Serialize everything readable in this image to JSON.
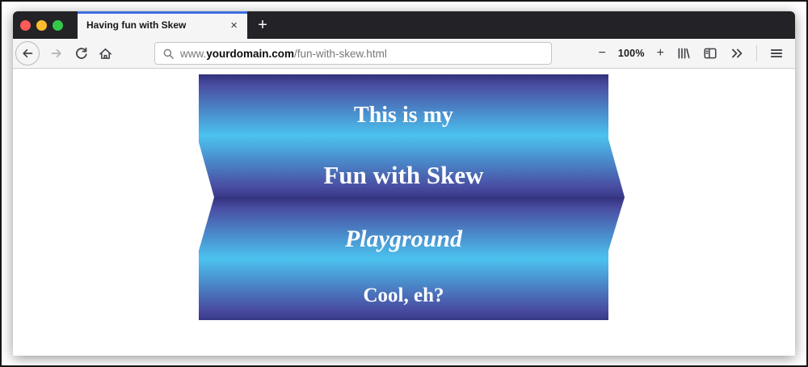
{
  "window": {
    "controls": [
      "close",
      "minimize",
      "zoom"
    ],
    "controls_colors": {
      "close": "#fc5b57",
      "minimize": "#fdbc2e",
      "zoom": "#34c84a"
    },
    "active_tab_line_color": "#3e6ede",
    "tabbar_color": "#232327",
    "toolbar_color": "#f5f5f6"
  },
  "tab": {
    "title": "Having fun with Skew",
    "close_glyph": "×",
    "new_tab_glyph": "+"
  },
  "toolbar": {
    "icons": [
      "back",
      "forward",
      "reload",
      "home",
      "search",
      "library",
      "sidebar",
      "overflow",
      "menu"
    ],
    "url_prefix": "www.",
    "url_domain": "yourdomain.com",
    "url_path": "/fun-with-skew.html",
    "zoom_out_glyph": "−",
    "zoom_level": "100%",
    "zoom_in_glyph": "+"
  },
  "page": {
    "lines": [
      {
        "text": "This is my",
        "style": "bold"
      },
      {
        "text": "Fun with Skew",
        "style": "bold"
      },
      {
        "text": "Playground",
        "style": "bold-italic"
      },
      {
        "text": "Cool, eh?",
        "style": "bold"
      }
    ],
    "colors": {
      "gradient_edge": "#31317b",
      "gradient_dark": "#4a4ea3",
      "gradient_cyan": "#4bc3ef",
      "text": "#ffffff"
    }
  }
}
